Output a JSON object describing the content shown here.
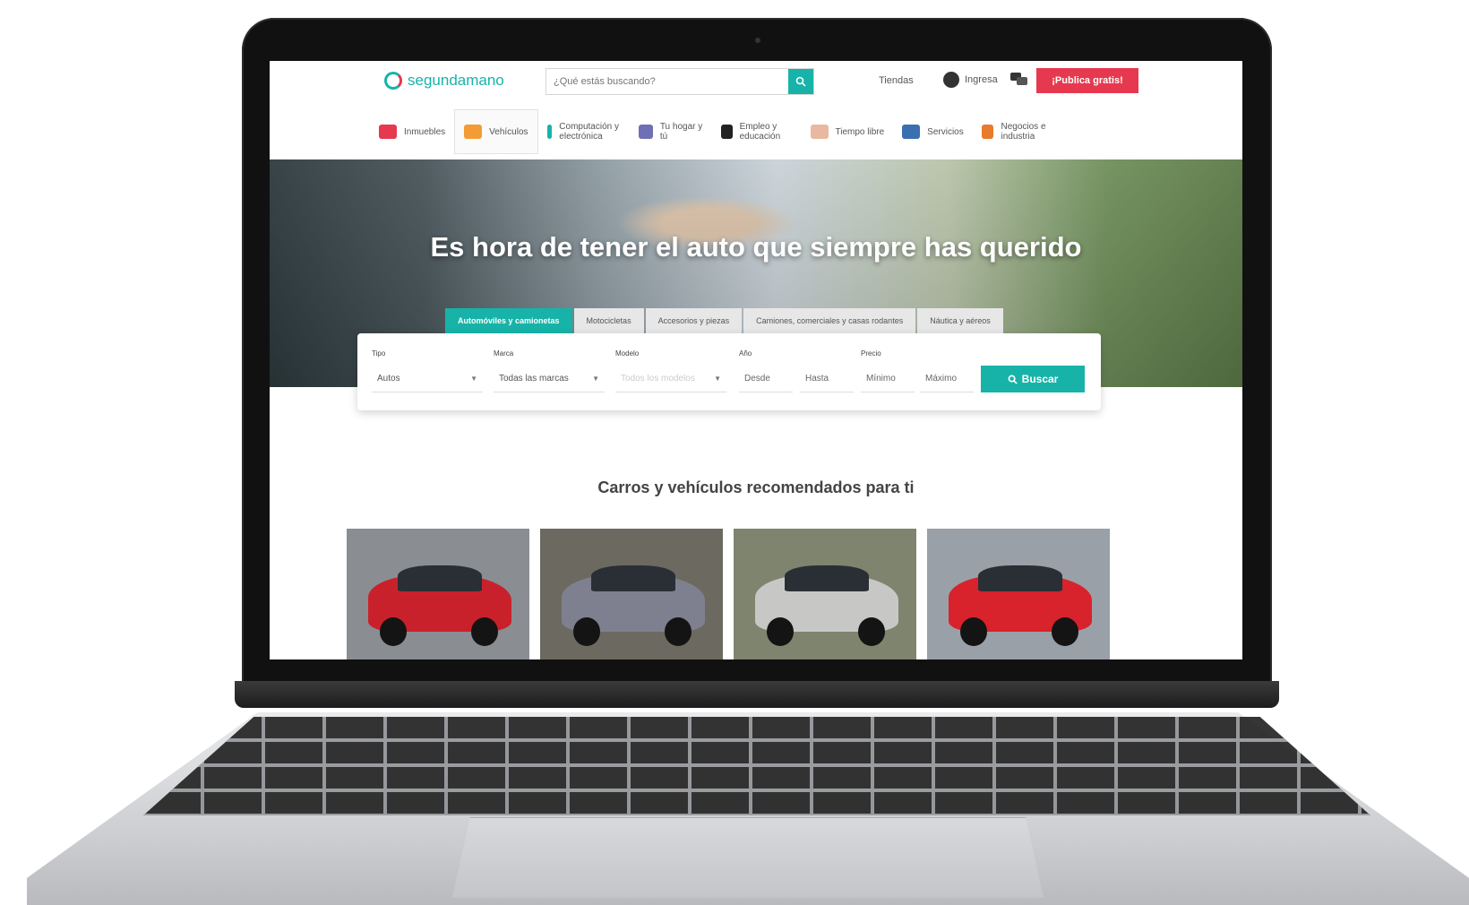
{
  "header": {
    "logo_text": "segundamano",
    "search_placeholder": "¿Qué estás buscando?",
    "tiendas": "Tiendas",
    "ingresa": "Ingresa",
    "publica": "¡Publica gratis!"
  },
  "categories": [
    {
      "label": "Inmuebles",
      "icon": "house-icon",
      "color": "#e6394f"
    },
    {
      "label": "Vehículos",
      "icon": "car-icon",
      "color": "#f39c35"
    },
    {
      "label": "Computación y electrónica",
      "icon": "phone-icon",
      "color": "#17b3a9"
    },
    {
      "label": "Tu hogar y tú",
      "icon": "sofa-icon",
      "color": "#6f6fb5"
    },
    {
      "label": "Empleo y educación",
      "icon": "graduation-cap-icon",
      "color": "#222222"
    },
    {
      "label": "Tiempo libre",
      "icon": "bicycle-icon",
      "color": "#e8b9a0"
    },
    {
      "label": "Servicios",
      "icon": "tools-icon",
      "color": "#3a6fb0"
    },
    {
      "label": "Negocios e industria",
      "icon": "briefcase-icon",
      "color": "#e87b2c"
    }
  ],
  "hero": {
    "title": "Es hora de tener el auto que siempre has querido"
  },
  "tabs": [
    "Automóviles y camionetas",
    "Motocicletas",
    "Accesorios y piezas",
    "Camiones, comerciales y casas rodantes",
    "Náutica y aéreos"
  ],
  "filters": {
    "tipo_label": "Tipo",
    "tipo_value": "Autos",
    "marca_label": "Marca",
    "marca_value": "Todas las marcas",
    "modelo_label": "Modelo",
    "modelo_value": "Todos los modelos",
    "anio_label": "Año",
    "desde": "Desde",
    "hasta": "Hasta",
    "precio_label": "Precio",
    "minimo": "Mínimo",
    "maximo": "Máximo",
    "buscar": "Buscar"
  },
  "recommended": {
    "title": "Carros y vehículos recomendados para ti",
    "cars": [
      {
        "color": "#c9212b",
        "bg": "#8a8d92"
      },
      {
        "color": "#7e8090",
        "bg": "#6c6a60"
      },
      {
        "color": "#c7c8c6",
        "bg": "#7f846f"
      },
      {
        "color": "#d8222c",
        "bg": "#9aa0a8"
      }
    ]
  }
}
